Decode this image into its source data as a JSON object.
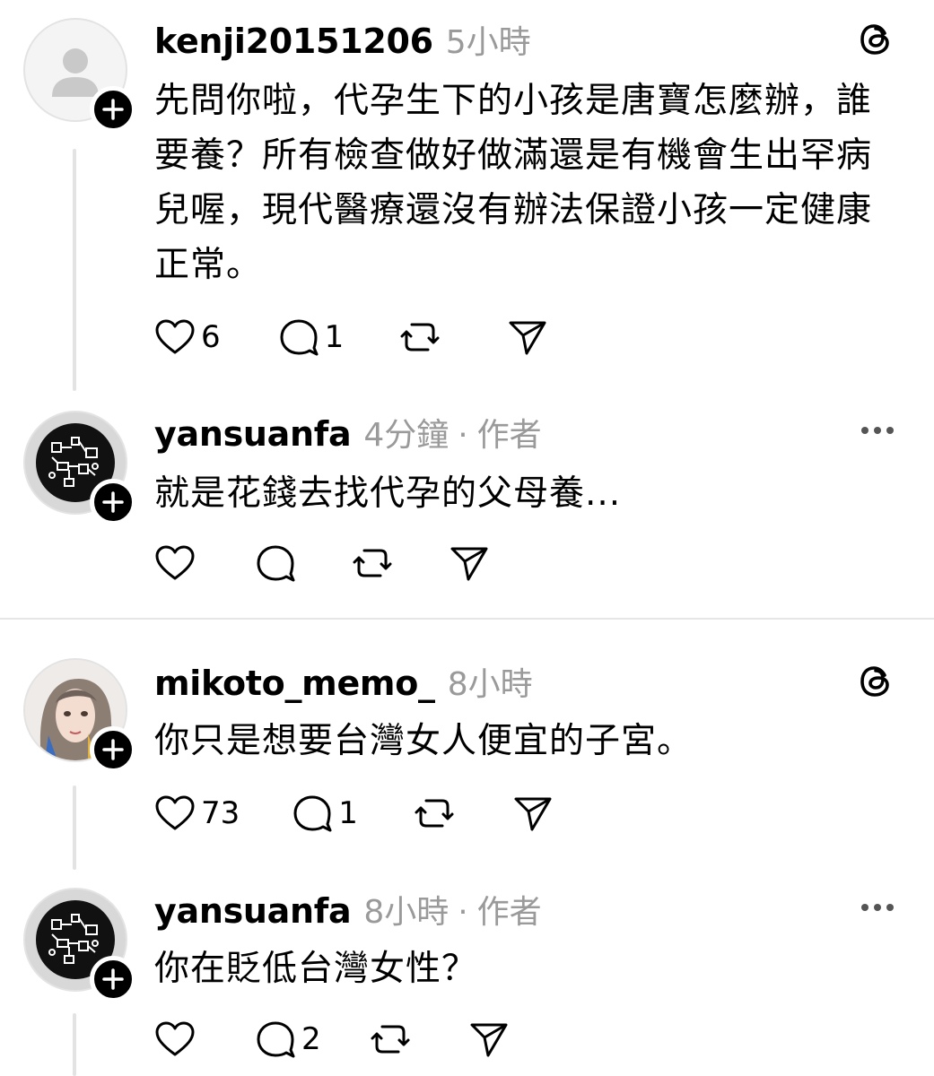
{
  "posts": [
    {
      "username": "kenji20151206",
      "time": "5小時",
      "author_tag": "",
      "text": "先問你啦，代孕生下的小孩是唐寶怎麼辦，誰要養？所有檢查做好做滿還是有機會生出罕病兒喔，現代醫療還沒有辦法保證小孩一定健康正常。",
      "likes": "6",
      "replies": "1",
      "avatar": "default-user-icon",
      "corner_icon": "threads-logo-icon"
    },
    {
      "username": "yansuanfa",
      "time": "4分鐘",
      "author_tag": "作者",
      "text": "就是花錢去找代孕的父母養...",
      "likes": "",
      "replies": "",
      "avatar": "pattern-avatar",
      "corner_icon": "more-icon"
    },
    {
      "username": "mikoto_memo_",
      "time": "8小時",
      "author_tag": "",
      "text": "你只是想要台灣女人便宜的子宮。",
      "likes": "73",
      "replies": "1",
      "avatar": "portrait-avatar",
      "corner_icon": "threads-logo-icon"
    },
    {
      "username": "yansuanfa",
      "time": "8小時",
      "author_tag": "作者",
      "text": "你在貶低台灣女性？",
      "likes": "",
      "replies": "2",
      "avatar": "pattern-avatar",
      "corner_icon": "more-icon"
    }
  ],
  "separator": "·",
  "icons": {
    "like": "heart-icon",
    "reply": "comment-icon",
    "repost": "repost-icon",
    "share": "send-icon",
    "follow": "plus-icon"
  }
}
